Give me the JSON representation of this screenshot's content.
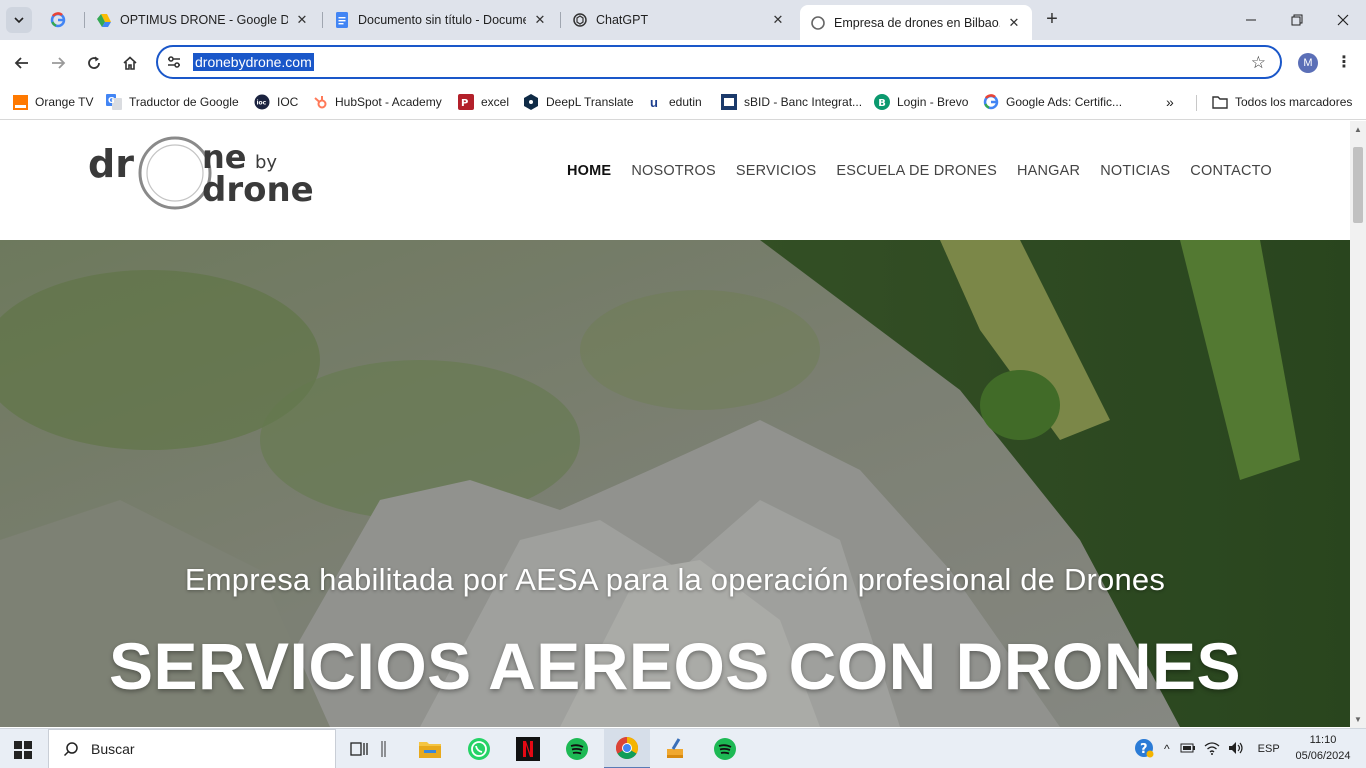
{
  "browser": {
    "tabs": [
      {
        "title": "",
        "icon": "google-icon"
      },
      {
        "title": "OPTIMUS DRONE - Google Drive",
        "icon": "google-drive-icon"
      },
      {
        "title": "Documento sin título - Documentos",
        "icon": "google-docs-icon"
      },
      {
        "title": "ChatGPT",
        "icon": "chatgpt-icon"
      },
      {
        "title": "Empresa de drones en Bilbao. R",
        "icon": "loading-icon",
        "active": true
      }
    ],
    "url": "dronebydrone.com",
    "profile_initial": "M",
    "bookmarks": [
      {
        "label": "Orange TV"
      },
      {
        "label": "Traductor de Google"
      },
      {
        "label": "IOC"
      },
      {
        "label": "HubSpot - Academy"
      },
      {
        "label": "excel"
      },
      {
        "label": "DeepL Translate"
      },
      {
        "label": "edutin"
      },
      {
        "label": "sBID - Banc Integrat..."
      },
      {
        "label": "Login - Brevo"
      },
      {
        "label": "Google Ads: Certific..."
      }
    ],
    "all_bookmarks_label": "Todos los marcadores"
  },
  "site": {
    "logo": {
      "line1": "dr",
      "line1b": "ne",
      "by": "by",
      "line2": "drone"
    },
    "nav": [
      {
        "label": "HOME",
        "active": true
      },
      {
        "label": "NOSOTROS"
      },
      {
        "label": "SERVICIOS"
      },
      {
        "label": "ESCUELA DE DRONES"
      },
      {
        "label": "HANGAR"
      },
      {
        "label": "NOTICIAS"
      },
      {
        "label": "CONTACTO"
      }
    ],
    "hero": {
      "subtitle": "Empresa habilitada por AESA para la operación profesional de Drones",
      "title": "SERVICIOS AEREOS CON DRONES"
    }
  },
  "taskbar": {
    "search_label": "Buscar",
    "language": "ESP",
    "time": "11:10",
    "date": "05/06/2024"
  },
  "colors": {
    "accent": "#1a57c9",
    "tabstrip": "#dfe3eb",
    "taskbar": "#e9eef5"
  }
}
